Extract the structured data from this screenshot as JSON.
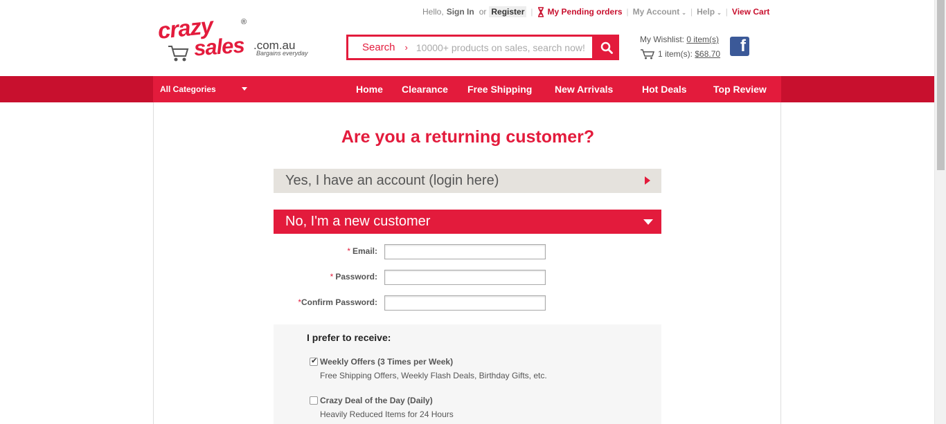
{
  "top_links": {
    "hello": "Hello,",
    "sign_in": "Sign In",
    "or": "or",
    "register": "Register",
    "pending": "My Pending orders",
    "account": "My Account",
    "help": "Help",
    "view_cart": "View Cart"
  },
  "logo": {
    "crazy": "crazy",
    "sales": "sales",
    "reg": "®",
    "domain": ".com.au",
    "tagline": "Bargains everyday"
  },
  "search": {
    "label": "Search",
    "arrow": "›",
    "placeholder": "10000+ products on sales, search now!"
  },
  "wishlist": {
    "label": "My Wishlist:",
    "count": "0 item(s)",
    "cart_items": "1 item(s):",
    "cart_total": "$68.70"
  },
  "facebook": {
    "glyph": "f"
  },
  "nav": {
    "all_categories": "All Categories",
    "items": [
      "Home",
      "Clearance",
      "Free Shipping",
      "New Arrivals",
      "Hot Deals",
      "Top Review"
    ]
  },
  "main": {
    "heading": "Are you a returning customer?",
    "yes_account": "Yes, I have an account (login here)",
    "new_customer": "No, I'm a new customer"
  },
  "form": {
    "required": "*",
    "email_label": "Email:",
    "password_label": "Password:",
    "confirm_label": "Confirm Password:"
  },
  "prefs": {
    "title": "I prefer to receive:",
    "options": [
      {
        "title": "Weekly Offers (3 Times per Week)",
        "desc": "Free Shipping Offers, Weekly Flash Deals, Birthday Gifts, etc.",
        "checked": true
      },
      {
        "title": "Crazy Deal of the Day (Daily)",
        "desc": "Heavily Reduced Items for 24 Hours",
        "checked": false
      }
    ]
  },
  "colors": {
    "brand_red": "#e31b3c",
    "nav_dark": "#c8102e",
    "facebook": "#3b5998"
  }
}
